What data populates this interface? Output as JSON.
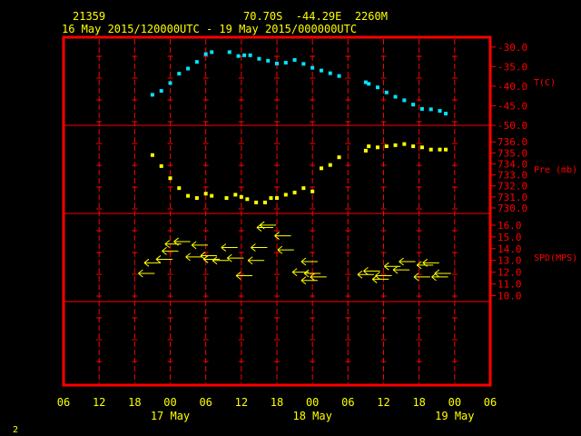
{
  "header": {
    "station_id": "21359",
    "location": "70.70S  -44.29E  2260M",
    "time_range": "16 May 2015/120000UTC - 19 May 2015/000000UTC"
  },
  "page_number": "2",
  "colors": {
    "background": "#000000",
    "frame": "#ff0000",
    "header_text": "#ffff00",
    "axis_text": "#ffff00",
    "panel_labels": "#ff0000",
    "temperature": "#00e5ff",
    "pressure": "#ffff00",
    "wind": "#ffff00"
  },
  "x_axis": {
    "tick_labels": [
      "06",
      "12",
      "18",
      "00",
      "06",
      "12",
      "18",
      "00",
      "06",
      "12",
      "18",
      "00",
      "06"
    ],
    "day_labels": [
      {
        "text": "17 May",
        "hour": 24
      },
      {
        "text": "18 May",
        "hour": 48
      },
      {
        "text": "19 May",
        "hour": 72
      }
    ]
  },
  "chart_data": [
    {
      "type": "scatter",
      "title": "",
      "ylabel": "T(C)",
      "xlabel": "",
      "x_unit": "hours since 16 May 2015 00:00 UTC",
      "xlim": [
        6,
        78
      ],
      "ylim": [
        -50.0,
        -27.5
      ],
      "y_ticks": [
        "-30.0",
        "-35.0",
        "-40.0",
        "-45.0",
        "-50.0"
      ],
      "y_tick_values": [
        -30,
        -35,
        -40,
        -45,
        -50
      ],
      "x": [
        21,
        22.5,
        24,
        25.5,
        27,
        28.5,
        30,
        31,
        34,
        35.5,
        36.5,
        37.5,
        39,
        40.5,
        42,
        43.5,
        45,
        46.5,
        48,
        49.5,
        51,
        52.5,
        57,
        57.5,
        59,
        60.5,
        62,
        63.5,
        65,
        66.5,
        68,
        69.5,
        70.5
      ],
      "y": [
        -42.2,
        -41.2,
        -39.2,
        -36.8,
        -35.5,
        -33.8,
        -31.8,
        -31.3,
        -31.3,
        -32.3,
        -32.1,
        -32.1,
        -33.0,
        -33.5,
        -34.2,
        -34.0,
        -33.3,
        -34.3,
        -35.3,
        -36.0,
        -36.7,
        -37.4,
        -39.0,
        -39.4,
        -40.3,
        -41.6,
        -42.7,
        -43.6,
        -44.7,
        -45.8,
        -45.9,
        -46.3,
        -47.0
      ]
    },
    {
      "type": "scatter",
      "title": "",
      "ylabel": "Pre (mb)",
      "xlabel": "",
      "x_unit": "hours since 16 May 2015 00:00 UTC",
      "xlim": [
        6,
        78
      ],
      "ylim": [
        729.5,
        737.5
      ],
      "y_ticks": [
        "736.0",
        "735.0",
        "734.0",
        "733.0",
        "732.0",
        "731.0",
        "730.0"
      ],
      "y_tick_values": [
        736,
        735,
        734,
        733,
        732,
        731,
        730
      ],
      "x": [
        21,
        22.5,
        24,
        25.5,
        27,
        28.5,
        30,
        31,
        33.5,
        35,
        36,
        37,
        38.5,
        40,
        41,
        42,
        43.5,
        45,
        46.5,
        48,
        49.5,
        51,
        52.5,
        57,
        57.5,
        59,
        60.5,
        62,
        63.5,
        65,
        66.5,
        68,
        69.5,
        70.5
      ],
      "y": [
        734.8,
        733.8,
        732.7,
        731.8,
        731.1,
        730.9,
        731.3,
        731.1,
        730.9,
        731.2,
        731.0,
        730.8,
        730.5,
        730.5,
        730.9,
        730.9,
        731.2,
        731.4,
        731.8,
        731.5,
        733.6,
        733.9,
        734.6,
        735.2,
        735.6,
        735.5,
        735.6,
        735.7,
        735.8,
        735.6,
        735.5,
        735.3,
        735.3,
        735.3
      ]
    },
    {
      "type": "scatter",
      "title": "",
      "ylabel": "SPD(MPS)",
      "xlabel": "",
      "x_unit": "hours since 16 May 2015 00:00 UTC",
      "xlim": [
        6,
        78
      ],
      "ylim": [
        9.5,
        17.0
      ],
      "y_ticks": [
        "16.0",
        "15.0",
        "14.0",
        "13.0",
        "12.0",
        "11.0",
        "10.0"
      ],
      "y_tick_values": [
        16,
        15,
        14,
        13,
        12,
        11,
        10
      ],
      "x": [
        20,
        21,
        23,
        24,
        24.5,
        26,
        26,
        28,
        29,
        30.5,
        31,
        32.5,
        34,
        35,
        36.5,
        38.5,
        39,
        40,
        40.5,
        43,
        43.5,
        46,
        47.5,
        47.5,
        48,
        49,
        57,
        58,
        59.5,
        60,
        61.5,
        63,
        64,
        66.5,
        67,
        68,
        69.5,
        70
      ],
      "y": [
        11.9,
        12.8,
        13.1,
        13.8,
        14.4,
        14.6,
        14.6,
        13.3,
        14.3,
        13.4,
        13.1,
        13.0,
        14.1,
        13.2,
        11.7,
        13.0,
        14.1,
        15.8,
        16.0,
        15.1,
        13.9,
        12.0,
        12.9,
        11.3,
        11.9,
        11.6,
        11.8,
        12.1,
        11.4,
        11.7,
        12.5,
        12.2,
        12.9,
        11.6,
        12.6,
        12.8,
        11.6,
        11.9
      ]
    }
  ]
}
